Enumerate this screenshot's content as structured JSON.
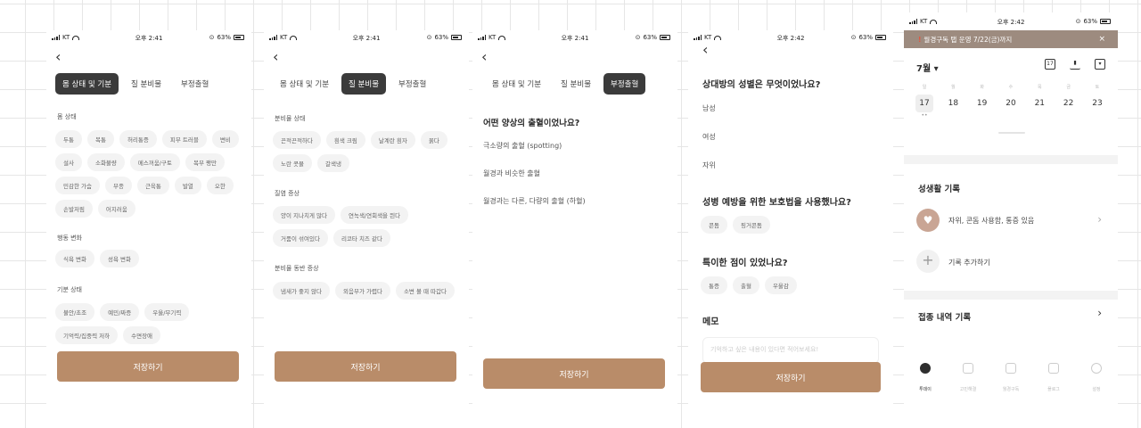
{
  "status_bars": [
    {
      "carrier": "KT",
      "time": "오후 2:41",
      "battery": "63%"
    },
    {
      "carrier": "KT",
      "time": "오후 2:41",
      "battery": "63%"
    },
    {
      "carrier": "KT",
      "time": "오후 2:41",
      "battery": "63%"
    },
    {
      "carrier": "KT",
      "time": "오후 2:42",
      "battery": "63%"
    },
    {
      "carrier": "KT",
      "time": "오후 2:42",
      "battery": "63%"
    }
  ],
  "tabs": [
    "몸 상태 및 기분",
    "질 분비물",
    "부정출혈"
  ],
  "save_label": "저장하기",
  "screen1": {
    "sections": [
      {
        "title": "몸 상태",
        "chips": [
          "두통",
          "복통",
          "허리통증",
          "피부 트러블",
          "변비",
          "설사",
          "소화불량",
          "메스꺼움/구토",
          "복부 팽만",
          "민감한 가슴",
          "부종",
          "근육통",
          "발열",
          "오한",
          "손발저림",
          "어지러움"
        ]
      },
      {
        "title": "행동 변화",
        "chips": [
          "식욕 변화",
          "성욕 변화"
        ]
      },
      {
        "title": "기분 상태",
        "chips": [
          "불안/초조",
          "예민/짜증",
          "우울/무기력",
          "기억력/집중력 저하",
          "수면장애"
        ]
      }
    ]
  },
  "screen2": {
    "sections": [
      {
        "title": "분비물 상태",
        "chips": [
          "끈적끈적하다",
          "흰색 크림",
          "날계란 흰자",
          "묽다",
          "노란 콧물",
          "갈색냉"
        ]
      },
      {
        "title": "질염 증상",
        "chips": [
          "양이 지나치게 많다",
          "연녹색/연회색을 띈다",
          "거품이 섞여있다",
          "리코타 치즈 같다"
        ]
      },
      {
        "title": "분비물 동반 증상",
        "chips": [
          "냄새가 좋지 않다",
          "외음부가 가렵다",
          "소변 볼 때 따갑다"
        ]
      }
    ]
  },
  "screen3": {
    "question": "어떤 양상의 출혈이었나요?",
    "options": [
      "극소량의 출혈 (spotting)",
      "월경과 비슷한 출혈",
      "월경과는 다른, 다량의 출혈 (하혈)"
    ]
  },
  "screen4": {
    "q1": "상대방의 성별은 무엇이었나요?",
    "q1_options": [
      "남성",
      "여성",
      "자위"
    ],
    "q2": "성병 예방을 위한 보호법을 사용했나요?",
    "q2_chips": [
      "콘돔",
      "핑거콘돔"
    ],
    "q3": "특이한 점이 있었나요?",
    "q3_chips": [
      "통증",
      "출혈",
      "우울감"
    ],
    "memo_title": "메모",
    "memo_placeholder": "기억하고 싶은 내용이 있다면 적어보세요!"
  },
  "screen5": {
    "banner": "월경구독 탭 운영 7/22(금)까지",
    "banner_mark": "!",
    "banner_close": "×",
    "month": "7월 ▾",
    "header_icons": [
      "calendar-icon",
      "chart-icon",
      "note-icon"
    ],
    "calendar_icon_text": "17",
    "weekdays": [
      "일",
      "월",
      "화",
      "수",
      "목",
      "금",
      "토"
    ],
    "dates": [
      "17",
      "18",
      "19",
      "20",
      "21",
      "22",
      "23"
    ],
    "selected_date": "17",
    "sexlife_title": "성생활 기록",
    "sexlife_entry": "자위, 콘돔 사용함, 통증 있음",
    "add_record": "기록 추가하기",
    "vaccine_title": "접종 내역 기록",
    "nav": [
      "투데이",
      "고민해결",
      "월경구독",
      "플로그",
      "설정"
    ]
  }
}
